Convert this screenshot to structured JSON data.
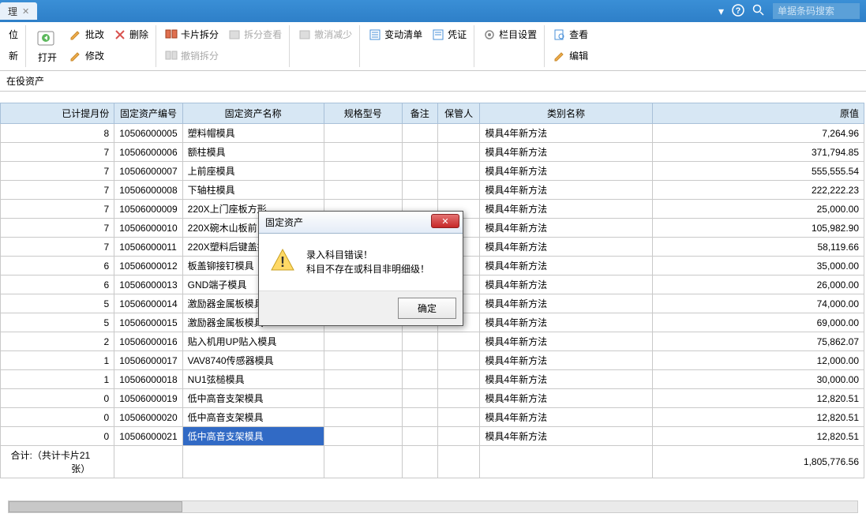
{
  "titlebar": {
    "tab_label": "理",
    "search_placeholder": "单据条码搜索"
  },
  "ribbon": {
    "new": "新",
    "open": "打开",
    "setup": "位",
    "edit_batch": "批改",
    "edit": "修改",
    "delete": "删除",
    "card_split": "卡片拆分",
    "split_revoke": "撤销拆分",
    "split_view": "拆分查看",
    "revoke_reduce": "撤消减少",
    "change_list": "变动清单",
    "voucher": "凭证",
    "column_set": "栏目设置",
    "view": "查看",
    "edit2": "编辑"
  },
  "section": {
    "title": "在役资产"
  },
  "table": {
    "headers": {
      "month": "已计提月份",
      "id": "固定资产编号",
      "name": "固定资产名称",
      "spec": "规格型号",
      "remark": "备注",
      "keeper": "保管人",
      "category": "类别名称",
      "value": "原值"
    },
    "rows": [
      {
        "month": "8",
        "id": "10506000005",
        "name": "塑料帽模具",
        "category": "模具4年新方法",
        "value": "7,264.96"
      },
      {
        "month": "7",
        "id": "10506000006",
        "name": "额柱模具",
        "category": "模具4年新方法",
        "value": "371,794.85"
      },
      {
        "month": "7",
        "id": "10506000007",
        "name": "上前座模具",
        "category": "模具4年新方法",
        "value": "555,555.54"
      },
      {
        "month": "7",
        "id": "10506000008",
        "name": "下轴柱模具",
        "category": "模具4年新方法",
        "value": "222,222.23"
      },
      {
        "month": "7",
        "id": "10506000009",
        "name": "220X上门座板方形",
        "category": "模具4年新方法",
        "value": "25,000.00"
      },
      {
        "month": "7",
        "id": "10506000010",
        "name": "220X碗木山板前（",
        "category": "模具4年新方法",
        "value": "105,982.90"
      },
      {
        "month": "7",
        "id": "10506000011",
        "name": "220X塑料后键盖搜",
        "category": "模具4年新方法",
        "value": "58,119.66"
      },
      {
        "month": "6",
        "id": "10506000012",
        "name": "板盖铆接钉模具",
        "category": "模具4年新方法",
        "value": "35,000.00"
      },
      {
        "month": "6",
        "id": "10506000013",
        "name": "GND端子模具",
        "category": "模具4年新方法",
        "value": "26,000.00"
      },
      {
        "month": "5",
        "id": "10506000014",
        "name": "激励器金属板模具",
        "category": "模具4年新方法",
        "value": "74,000.00"
      },
      {
        "month": "5",
        "id": "10506000015",
        "name": "激励器金属板模具",
        "category": "模具4年新方法",
        "value": "69,000.00"
      },
      {
        "month": "2",
        "id": "10506000016",
        "name": "贴入机用UP贴入模具",
        "category": "模具4年新方法",
        "value": "75,862.07"
      },
      {
        "month": "1",
        "id": "10506000017",
        "name": "VAV8740传感器模具",
        "category": "模具4年新方法",
        "value": "12,000.00"
      },
      {
        "month": "1",
        "id": "10506000018",
        "name": "NU1弦槌模具",
        "category": "模具4年新方法",
        "value": "30,000.00"
      },
      {
        "month": "0",
        "id": "10506000019",
        "name": "低中高音支架模具",
        "category": "模具4年新方法",
        "value": "12,820.51"
      },
      {
        "month": "0",
        "id": "10506000020",
        "name": "低中高音支架模具",
        "category": "模具4年新方法",
        "value": "12,820.51"
      },
      {
        "month": "0",
        "id": "10506000021",
        "name": "低中高音支架模具",
        "category": "模具4年新方法",
        "value": "12,820.51",
        "selected": true
      }
    ],
    "summary": {
      "label": "合计:（共计卡片21张）",
      "value": "1,805,776.56"
    }
  },
  "dialog": {
    "title": "固定资产",
    "line1": "录入科目错误！",
    "line2": "科目不存在或科目非明细级！",
    "ok": "确定"
  }
}
